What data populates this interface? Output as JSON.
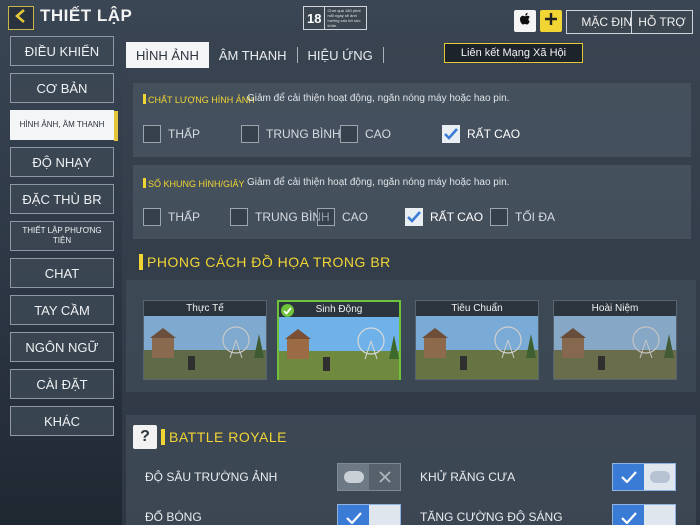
{
  "header": {
    "title": "THIẾT LẬP",
    "age_rating": "18",
    "age_warning": "Chơi quá 180 phút mỗi ngày sẽ ảnh hưởng xấu tới sức khỏe.",
    "default_label": "MẶC ĐỊNH",
    "support_label": "HỖ TRỢ",
    "social_tooltip": "Liên kết Mạng Xã Hội"
  },
  "sidebar": {
    "items": [
      {
        "label": "ĐIỀU KHIỂN"
      },
      {
        "label": "CƠ BẢN"
      },
      {
        "label": "HÌNH ẢNH, ÂM THANH"
      },
      {
        "label": "ĐỘ NHẠY"
      },
      {
        "label": "ĐẶC THÙ BR"
      },
      {
        "label": "THIẾT LẬP PHƯƠNG TIỆN"
      },
      {
        "label": "CHAT"
      },
      {
        "label": "TAY CẦM"
      },
      {
        "label": "NGÔN NGỮ"
      },
      {
        "label": "CÀI ĐẶT"
      },
      {
        "label": "KHÁC"
      }
    ],
    "active_index": 2
  },
  "tabs": [
    {
      "label": "HÌNH ẢNH",
      "active": true
    },
    {
      "label": "ÂM THANH",
      "active": false
    },
    {
      "label": "HIỆU ỨNG",
      "active": false
    }
  ],
  "graphics_quality": {
    "label": "CHẤT LƯỢNG HÌNH ẢNH",
    "description": "Giảm để cải thiện hoạt động, ngăn nóng máy hoặc hao pin.",
    "options": [
      "THẤP",
      "TRUNG BÌNH",
      "CAO",
      "RẤT CAO"
    ],
    "selected": "RẤT CAO"
  },
  "frame_rate": {
    "label": "SỐ KHUNG HÌNH/GIÂY",
    "description": "Giảm để cải thiện hoạt động, ngăn nóng máy hoặc hao pin.",
    "options": [
      "THẤP",
      "TRUNG BÌNH",
      "CAO",
      "RẤT CAO",
      "TỐI ĐA"
    ],
    "selected": "RẤT CAO"
  },
  "br_style": {
    "title": "PHONG CÁCH ĐỒ HỌA TRONG BR",
    "options": [
      "Thực Tế",
      "Sinh Động",
      "Tiêu Chuẩn",
      "Hoài Niệm"
    ],
    "selected": "Sinh Động"
  },
  "battle_royale": {
    "title": "BATTLE ROYALE",
    "help_label": "?",
    "toggles": [
      {
        "label": "ĐỘ SÂU TRƯỜNG ẢNH",
        "on": false
      },
      {
        "label": "KHỬ RĂNG CƯA",
        "on": true
      },
      {
        "label": "ĐỔ BÓNG",
        "on": true
      },
      {
        "label": "TĂNG CƯỜNG ĐỘ SÁNG",
        "on": true
      }
    ]
  },
  "colors": {
    "accent": "#f1d534",
    "selected_border": "#6ec33b"
  }
}
